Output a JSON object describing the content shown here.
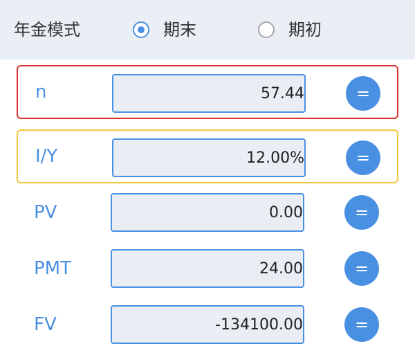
{
  "header": {
    "mode_label": "年金模式",
    "options": [
      {
        "label": "期末",
        "checked": true
      },
      {
        "label": "期初",
        "checked": false
      }
    ]
  },
  "fields": [
    {
      "label": "n",
      "value": "57.44",
      "highlight": "red"
    },
    {
      "label": "I/Y",
      "value": "12.00%",
      "highlight": "yellow"
    },
    {
      "label": "PV",
      "value": "0.00",
      "highlight": "none"
    },
    {
      "label": "PMT",
      "value": "24.00",
      "highlight": "none"
    },
    {
      "label": "FV",
      "value": "-134100.00",
      "highlight": "none"
    }
  ],
  "compute_button_label": "=",
  "colors": {
    "accent": "#4a90e2",
    "header_bg": "#eaeff6",
    "input_bg": "#eaeef4",
    "highlight_red": "#d9322d",
    "highlight_yellow": "#f2c73a"
  }
}
